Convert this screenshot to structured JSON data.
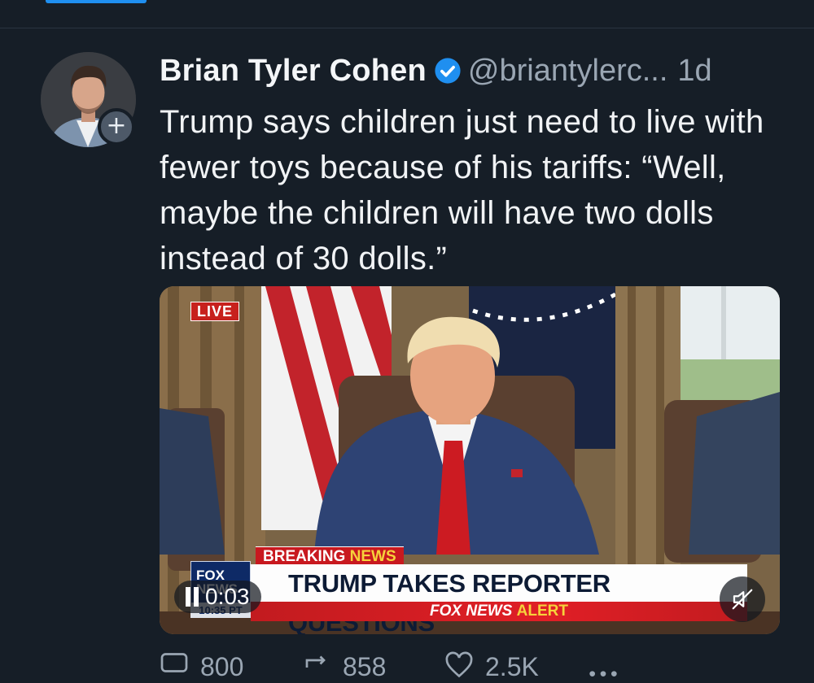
{
  "post": {
    "display_name": "Brian Tyler Cohen",
    "handle": "@briantylerc...",
    "time": "1d",
    "text": "Trump says children just need to live with fewer toys because of his tariffs: “Well, maybe the children will have two dolls instead of 30 dolls.”",
    "follow_badge": "+"
  },
  "video": {
    "live_label": "LIVE",
    "breaking_label": "BREAKING",
    "breaking_news_label": "NEWS",
    "headline": "TRUMP TAKES REPORTER QUESTIONS",
    "alert_brand": "FOX NEWS",
    "alert_label": "ALERT",
    "logo_text": "FOX NEWS",
    "channel_time": "10:35 PT",
    "elapsed": "0:03"
  },
  "actions": [
    {
      "icon": "reply-icon",
      "count": "800"
    },
    {
      "icon": "repost-icon",
      "count": "858"
    },
    {
      "icon": "like-icon",
      "count": "2.5K"
    },
    {
      "icon": "more-icon",
      "count": ""
    }
  ],
  "colors": {
    "background": "#161e27",
    "accent": "#1f8ff0",
    "muted_text": "#9aa6b3"
  }
}
